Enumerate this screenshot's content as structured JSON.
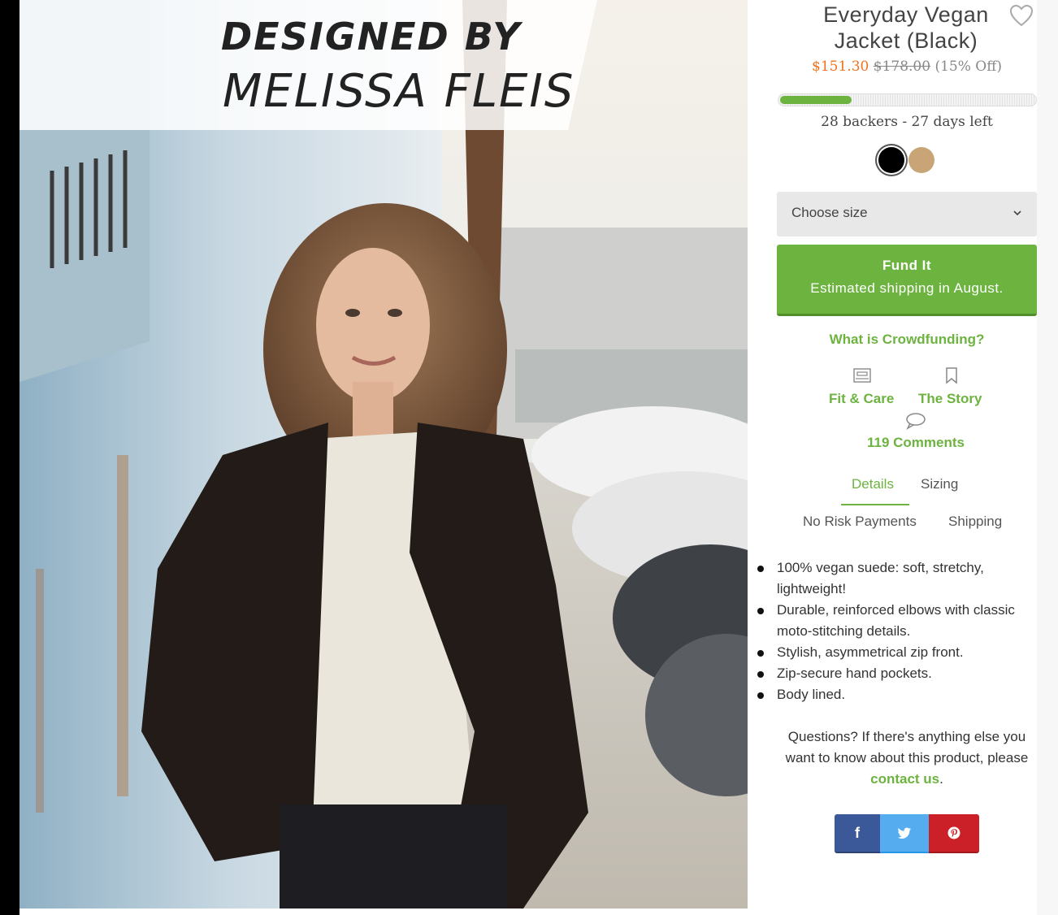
{
  "hero": {
    "banner_line1": "DESIGNED BY",
    "banner_line2": "MELISSA FLEIS"
  },
  "product": {
    "title": "Everyday Vegan Jacket (Black)",
    "price_sale": "$151.30",
    "price_original": "$178.00",
    "price_discount": "(15% Off)",
    "funding_progress_fraction": 0.28,
    "backers_text": "28 backers - 27 days left",
    "colors": [
      {
        "name": "black",
        "hex": "#000000",
        "selected": true
      },
      {
        "name": "tan",
        "hex": "#c9a476",
        "selected": false
      }
    ]
  },
  "size_select": {
    "label": "Choose size"
  },
  "fund_button": {
    "line1": "Fund It",
    "line2": "Estimated shipping in August."
  },
  "links": {
    "crowdfunding": "What is Crowdfunding?",
    "fit_care": "Fit & Care",
    "story": "The Story",
    "comments": "119 Comments"
  },
  "tabs": {
    "details": "Details",
    "sizing": "Sizing",
    "no_risk": "No Risk Payments",
    "shipping": "Shipping"
  },
  "details_list": [
    "100% vegan suede: soft, stretchy, lightweight!",
    "Durable, reinforced elbows with classic moto-stitching details.",
    "Stylish, asymmetrical zip front.",
    "Zip-secure hand pockets.",
    "Body lined."
  ],
  "questions": {
    "text_before": "Questions? If there's anything else you want to know about this product, please ",
    "link": "contact us",
    "text_after": "."
  },
  "share": {
    "facebook": "f",
    "twitter_icon": "twitter-icon",
    "pinterest_icon": "pinterest-icon"
  },
  "colors": {
    "accent_green": "#6db33f",
    "sale_orange": "#f0721e",
    "facebook_blue": "#3b5998",
    "twitter_blue": "#55acee",
    "pinterest_red": "#cb2027"
  }
}
